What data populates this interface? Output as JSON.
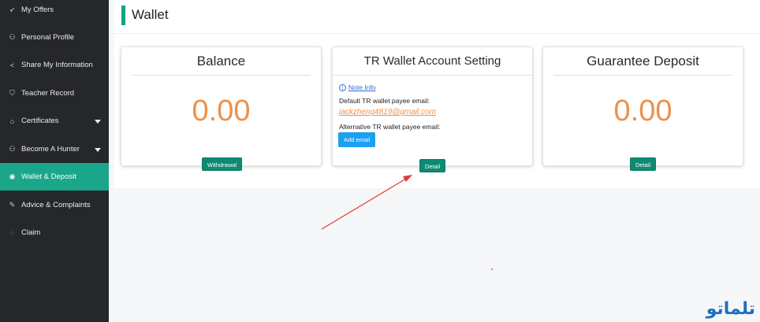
{
  "sidebar": {
    "items": [
      {
        "label": "My Offers",
        "icon": "send-icon",
        "glyph": "➶"
      },
      {
        "label": "Personal Profile",
        "icon": "user-icon",
        "glyph": "⚇"
      },
      {
        "label": "Share My Information",
        "icon": "share-icon",
        "glyph": "<"
      },
      {
        "label": "Teacher Record",
        "icon": "shield-icon",
        "glyph": "⛉"
      },
      {
        "label": "Certificates",
        "icon": "certificate-icon",
        "glyph": "⌂"
      },
      {
        "label": "Become A Hunter",
        "icon": "user-plus-icon",
        "glyph": "⚇"
      },
      {
        "label": "Wallet & Deposit",
        "icon": "wallet-icon",
        "glyph": "◉"
      },
      {
        "label": "Advice & Complaints",
        "icon": "edit-icon",
        "glyph": "✎"
      },
      {
        "label": "Claim",
        "icon": "claim-icon",
        "glyph": "◌"
      }
    ]
  },
  "page": {
    "title": "Wallet"
  },
  "balance": {
    "title": "Balance",
    "value": "0.00",
    "button": "Withdrawal"
  },
  "tr_wallet": {
    "title": "TR Wallet Account Setting",
    "note_link": "Note Info",
    "default_label": "Default TR wallet payee email:",
    "default_email": "jackzheng4819@gmail.com",
    "alt_label": "Alternative TR wallet payee email:",
    "add_button": "Add email",
    "detail_button": "Detail"
  },
  "guarantee": {
    "title": "Guarantee Deposit",
    "value": "0.00",
    "button": "Detail"
  },
  "logo": {
    "text": "تلماتو"
  },
  "colors": {
    "accent": "#1aa68a",
    "number": "#ec914b",
    "arrow": "#e53935"
  }
}
